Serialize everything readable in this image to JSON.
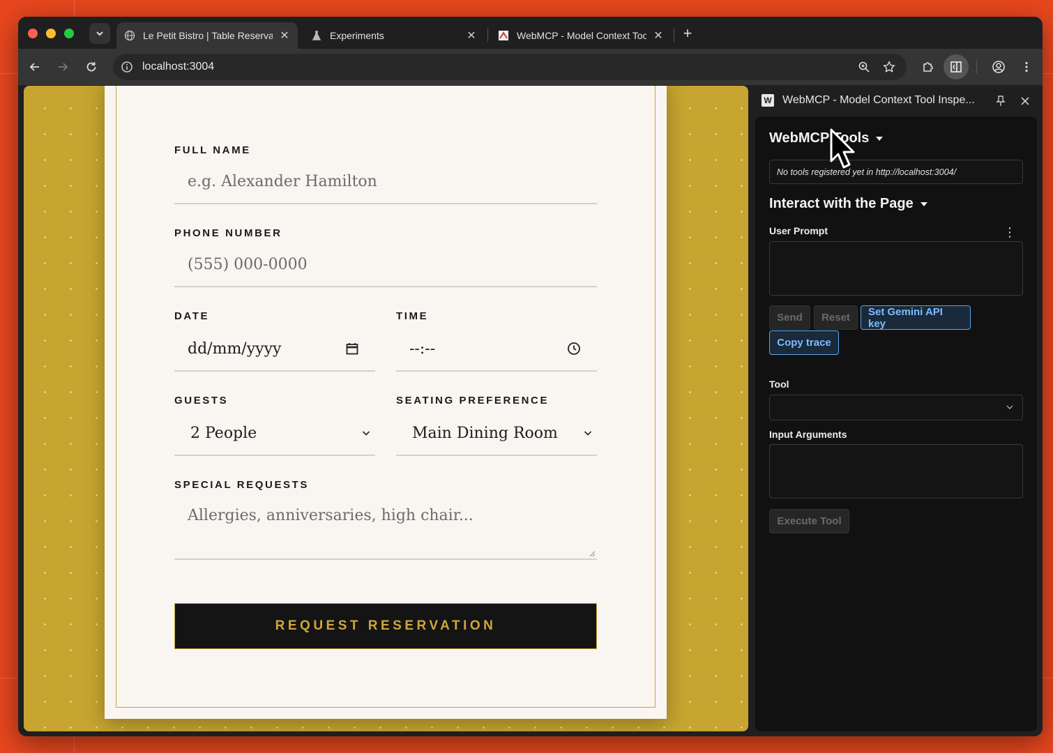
{
  "browser": {
    "tabs": [
      {
        "title": "Le Petit Bistro | Table Reservation",
        "active": true,
        "icon": "globe-icon"
      },
      {
        "title": "Experiments",
        "active": false,
        "icon": "flask-icon"
      },
      {
        "title": "WebMCP - Model Context Tool Inspector",
        "active": false,
        "icon": "webmcp-favicon"
      }
    ],
    "url": "localhost:3004"
  },
  "form": {
    "full_name": {
      "label": "FULL NAME",
      "placeholder": "e.g. Alexander Hamilton"
    },
    "phone": {
      "label": "PHONE NUMBER",
      "placeholder": "(555) 000-0000"
    },
    "date": {
      "label": "DATE",
      "placeholder": "dd/mm/yyyy"
    },
    "time": {
      "label": "TIME",
      "placeholder": "--:--"
    },
    "guests": {
      "label": "GUESTS",
      "value": "2 People"
    },
    "seating": {
      "label": "SEATING PREFERENCE",
      "value": "Main Dining Room"
    },
    "requests": {
      "label": "SPECIAL REQUESTS",
      "placeholder": "Allergies, anniversaries, high chair..."
    },
    "submit_label": "REQUEST RESERVATION"
  },
  "side_panel": {
    "title": "WebMCP - Model Context Tool Inspe...",
    "favicon_letter": "W",
    "tools_heading": "WebMCP Tools",
    "tools_status": "No tools registered yet in http://localhost:3004/",
    "interact_heading": "Interact with the Page",
    "user_prompt_label": "User Prompt",
    "send_label": "Send",
    "reset_label": "Reset",
    "gemini_label": "Set Gemini API key",
    "copy_trace_label": "Copy trace",
    "tool_label": "Tool",
    "input_args_label": "Input Arguments",
    "execute_label": "Execute Tool"
  },
  "colors": {
    "background": "#e8471e",
    "page_gold": "#c7a530",
    "button_text_gold": "#cfa73a",
    "accent_blue": "#5aa6f0"
  }
}
